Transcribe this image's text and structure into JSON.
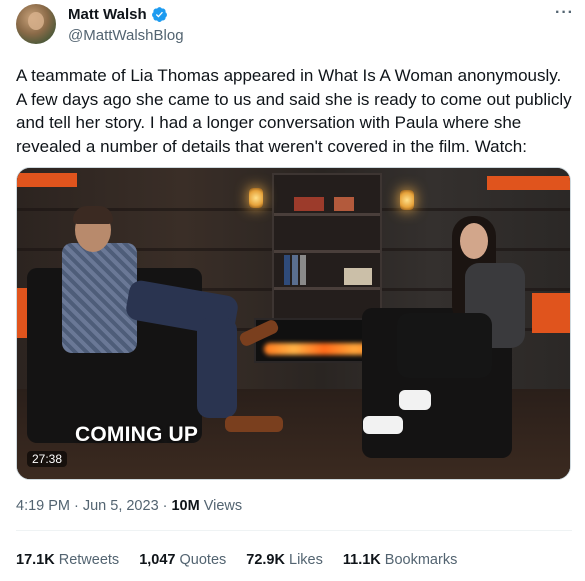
{
  "author": {
    "name": "Matt Walsh",
    "handle": "@MattWalshBlog",
    "avatar_icon": "profile-avatar",
    "verified_color": "#1d9bf0"
  },
  "more_icon": "···",
  "tweet": {
    "text": "A teammate of Lia Thomas appeared in What Is A Woman anonymously. A few days ago she came to us and said she is ready to come out publicly and tell her story. I had a longer conversation with Paula where she revealed a number of details that weren't covered in the film. Watch:"
  },
  "media": {
    "overlay_text": "COMING UP",
    "duration": "27:38",
    "accent_color": "#e0541d"
  },
  "meta": {
    "time": "4:19 PM",
    "separator": "·",
    "date": "Jun 5, 2023",
    "views_count": "10M",
    "views_label": "Views"
  },
  "stats": {
    "retweets": {
      "count": "17.1K",
      "label": "Retweets"
    },
    "quotes": {
      "count": "1,047",
      "label": "Quotes"
    },
    "likes": {
      "count": "72.9K",
      "label": "Likes"
    },
    "bookmarks": {
      "count": "11.1K",
      "label": "Bookmarks"
    }
  }
}
